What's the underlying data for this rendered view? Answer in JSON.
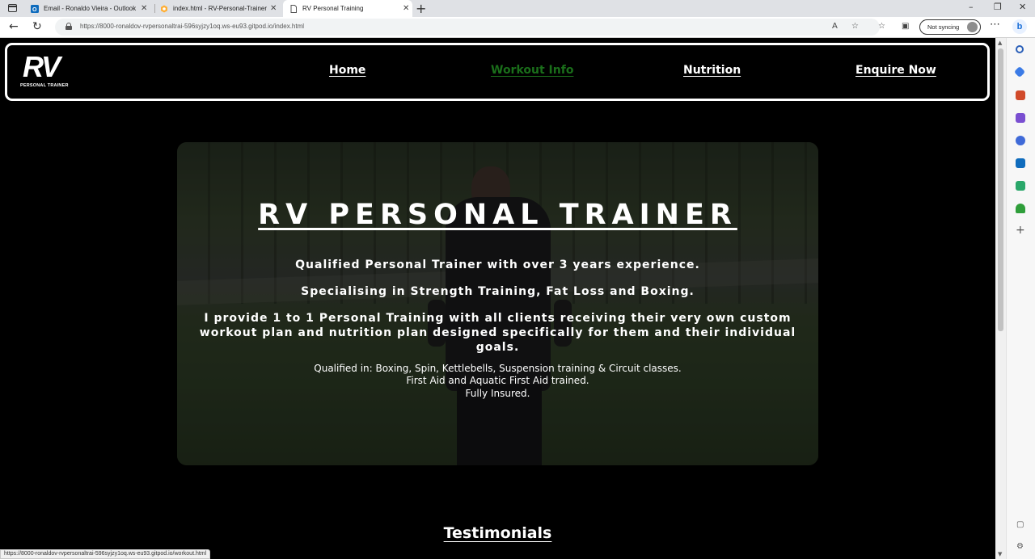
{
  "browser": {
    "tabs": [
      {
        "title": "Email - Ronaldo Vieira - Outlook",
        "icon": "outlook-icon"
      },
      {
        "title": "index.html - RV-Personal-Trainer",
        "icon": "gitpod-icon"
      },
      {
        "title": "RV Personal Training",
        "icon": "page-icon"
      }
    ],
    "url": "https://8000-ronaldov-rvpersonaltrai-596syjzy1oq.ws-eu93.gitpod.io/index.html",
    "sync_label": "Not syncing",
    "status_url": "https://8000-ronaldov-rvpersonaltrai-596syjzy1oq.ws-eu93.gitpod.io/workout.html"
  },
  "site": {
    "logo": {
      "mark": "RV",
      "subtitle": "PERSONAL TRAINER"
    },
    "nav": [
      {
        "label": "Home"
      },
      {
        "label": "Workout Info"
      },
      {
        "label": "Nutrition"
      },
      {
        "label": "Enquire Now"
      }
    ],
    "nav_hover_color": "#1a6e1a",
    "hero": {
      "title": "RV PERSONAL TRAINER",
      "line1": "Qualified Personal Trainer with over 3 years experience.",
      "line2": "Specialising in Strength Training, Fat Loss and Boxing.",
      "line3": "I provide 1 to 1 Personal Training with all clients receiving their very own custom workout plan and nutrition plan designed specifically for them and their individual goals.",
      "small1": "Qualified in: Boxing, Spin, Kettlebells, Suspension training & Circuit classes.",
      "small2": "First Aid and Aquatic First Aid trained.",
      "small3": "Fully Insured."
    },
    "testimonials_heading": "Testimonials"
  }
}
